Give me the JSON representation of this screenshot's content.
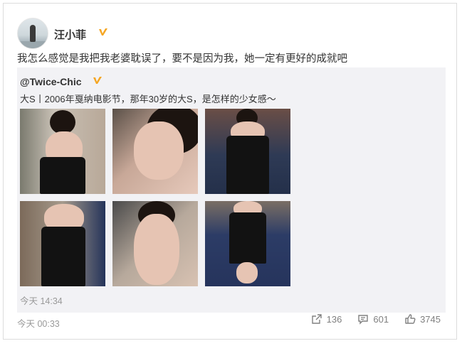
{
  "post": {
    "author": "汪小菲",
    "text": "我怎么感觉是我把我老婆耽误了，要不是因为我，她一定有更好的成就吧",
    "time": "今天 00:33"
  },
  "repost": {
    "handle": "@Twice-Chic",
    "text": "大S丨2006年戛纳电影节，那年30岁的大S，是怎样的少女感～",
    "time": "今天 14:34"
  },
  "actions": {
    "share_count": "136",
    "comment_count": "601",
    "like_count": "3745"
  },
  "colors": {
    "verified_badge": "#f5a623",
    "meta_text": "#999999",
    "repost_bg": "#f2f2f5"
  },
  "icons": [
    "verified-badge-icon",
    "share-icon",
    "comment-icon",
    "like-icon"
  ]
}
